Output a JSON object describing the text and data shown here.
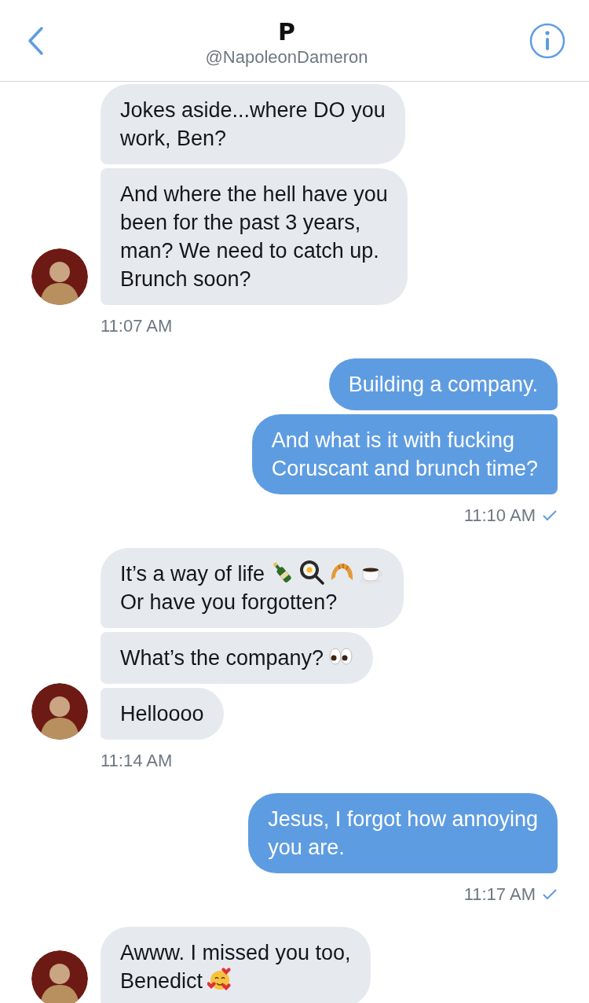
{
  "header": {
    "title": "P",
    "handle": "@NapoleonDameron"
  },
  "groups": [
    {
      "kind": "received",
      "messages": [
        {
          "parts": [
            {
              "kind": "text",
              "text": "Jokes aside...where DO you\nwork, Ben?"
            }
          ]
        },
        {
          "parts": [
            {
              "kind": "text",
              "text": "And where the hell have you\nbeen for the past 3 years,\nman? We need to catch up.\nBrunch soon?"
            }
          ]
        }
      ],
      "time": "11:07 AM"
    },
    {
      "kind": "sent",
      "messages": [
        {
          "parts": [
            {
              "kind": "text",
              "text": "Building a company."
            }
          ]
        },
        {
          "parts": [
            {
              "kind": "text",
              "text": "And what is it with fucking\nCoruscant and brunch time?"
            }
          ]
        }
      ],
      "time": "11:10 AM",
      "read": true
    },
    {
      "kind": "received",
      "messages": [
        {
          "parts": [
            {
              "kind": "text",
              "text": "It’s a way of life"
            },
            {
              "kind": "bottle"
            },
            {
              "kind": "pan"
            },
            {
              "kind": "croissant"
            },
            {
              "kind": "coffee"
            },
            {
              "kind": "break"
            },
            {
              "kind": "text",
              "text": "Or have you forgotten?"
            }
          ]
        },
        {
          "parts": [
            {
              "kind": "text",
              "text": "What’s the company?"
            },
            {
              "kind": "eyes"
            }
          ]
        },
        {
          "parts": [
            {
              "kind": "text",
              "text": "Helloooo"
            }
          ]
        }
      ],
      "time": "11:14 AM"
    },
    {
      "kind": "sent",
      "messages": [
        {
          "parts": [
            {
              "kind": "text",
              "text": "Jesus, I forgot how annoying\nyou are."
            }
          ]
        }
      ],
      "time": "11:17 AM",
      "read": true
    },
    {
      "kind": "received",
      "messages": [
        {
          "parts": [
            {
              "kind": "text",
              "text": "Awww. I missed you too,"
            },
            {
              "kind": "break"
            },
            {
              "kind": "text",
              "text": "Benedict"
            },
            {
              "kind": "hearts-smiley"
            }
          ]
        }
      ]
    }
  ]
}
